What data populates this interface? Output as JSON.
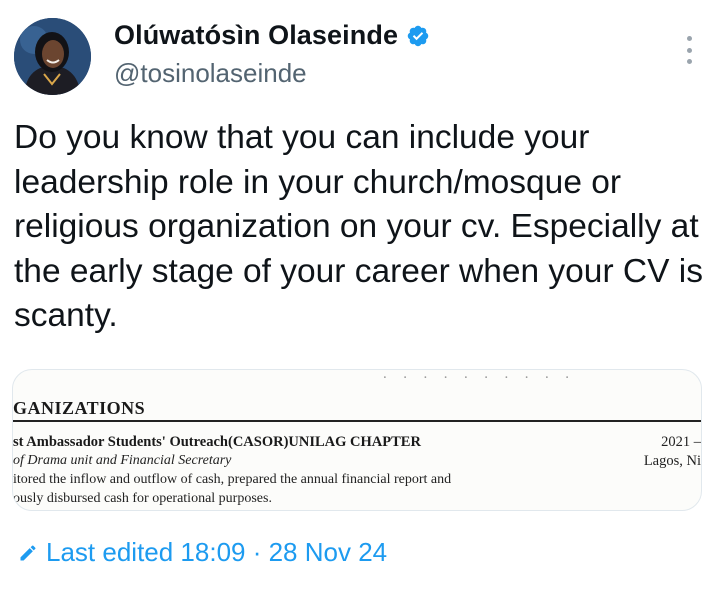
{
  "author": {
    "display_name": "Olúwatósìn Olaseinde",
    "handle": "@tosinolaseinde",
    "verified": true,
    "avatar": "profile-photo"
  },
  "tweet": {
    "text": "Do you know that you can include your leadership role in your church/mosque or religious organization on your cv. Especially at the early stage of your career when your CV is scanty."
  },
  "media": {
    "section_heading": "GANIZATIONS",
    "organization": "st Ambassador Students' Outreach(CASOR)UNILAG CHAPTER",
    "role": "of Drama unit and Financial Secretary",
    "line1": "itored the inflow and outflow of cash, prepared the annual financial report and",
    "line2": "ously disbursed cash for operational purposes.",
    "year": "2021 –",
    "place": "Lagos, Ni"
  },
  "footer": {
    "edited_label": "Last edited 18:09 · 28 Nov 24"
  },
  "colors": {
    "accent": "#1d9bf0",
    "secondary_text": "#536471",
    "text": "#0f1419"
  },
  "icons": [
    "verified-badge-icon",
    "more-options-icon",
    "edit-pencil-icon"
  ]
}
